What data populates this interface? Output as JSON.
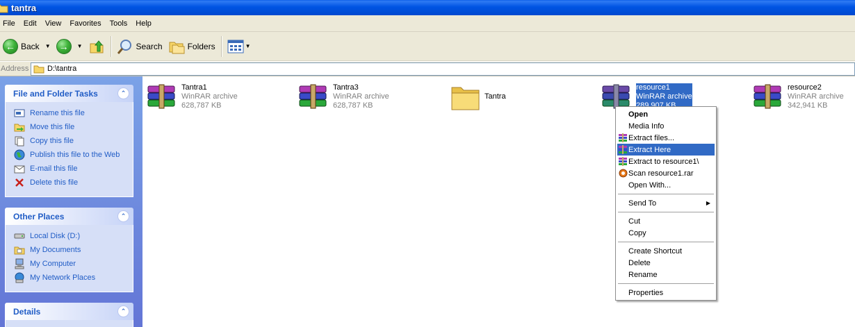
{
  "window": {
    "title": "tantra"
  },
  "menu": [
    "File",
    "Edit",
    "View",
    "Favorites",
    "Tools",
    "Help"
  ],
  "toolbar": {
    "back": "Back",
    "search": "Search",
    "folders": "Folders"
  },
  "address": {
    "label": "Address",
    "path": "D:\\tantra"
  },
  "tasks": {
    "title": "File and Folder Tasks",
    "items": [
      "Rename this file",
      "Move this file",
      "Copy this file",
      "Publish this file to the Web",
      "E-mail this file",
      "Delete this file"
    ]
  },
  "places": {
    "title": "Other Places",
    "items": [
      "Local Disk (D:)",
      "My Documents",
      "My Computer",
      "My Network Places"
    ]
  },
  "details": {
    "title": "Details"
  },
  "files": [
    {
      "name": "Tantra1",
      "type": "WinRAR archive",
      "size": "628,787 KB"
    },
    {
      "name": "Tantra3",
      "type": "WinRAR archive",
      "size": "628,787 KB"
    },
    {
      "name": "Tantra"
    },
    {
      "name": "resource1",
      "type": "WinRAR archive",
      "size": "289,907 KB"
    },
    {
      "name": "resource2",
      "type": "WinRAR archive",
      "size": "342,941 KB"
    }
  ],
  "context_menu": [
    "Open",
    "Media Info",
    "Extract files...",
    "Extract Here",
    "Extract to resource1\\",
    "Scan resource1.rar",
    "Open With...",
    "Send To",
    "Cut",
    "Copy",
    "Create Shortcut",
    "Delete",
    "Rename",
    "Properties"
  ],
  "colors": {
    "title_blue": "#0054e3",
    "task_link": "#215dc6",
    "selection": "#316ac5",
    "chrome": "#ece9d8"
  }
}
